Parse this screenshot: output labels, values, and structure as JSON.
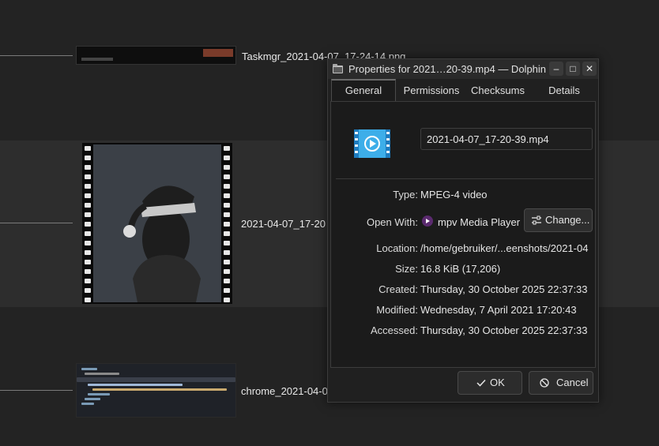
{
  "files": [
    {
      "name": "Taskmgr_2021-04-07_17-24-14.png"
    },
    {
      "name": "2021-04-07_17-20"
    },
    {
      "name": "chrome_2021-04-0"
    }
  ],
  "dialog": {
    "title": "Properties for 2021…20-39.mp4 — Dolphin",
    "window_buttons": {
      "minimize": "–",
      "maximize": "□",
      "close": "✕"
    },
    "tabs": [
      {
        "label": "General",
        "active": true
      },
      {
        "label": "Permissions",
        "active": false
      },
      {
        "label": "Checksums",
        "active": false
      },
      {
        "label": "Details",
        "active": false
      }
    ],
    "filename": "2021-04-07_17-20-39.mp4",
    "fields": {
      "type_label": "Type:",
      "type_value": "MPEG-4 video",
      "open_with_label": "Open With:",
      "open_with_value": "mpv Media Player",
      "change_button": "Change...",
      "location_label": "Location:",
      "location_value": "/home/gebruiker/...eenshots/2021-04",
      "size_label": "Size:",
      "size_value": "16.8 KiB (17,206)",
      "created_label": "Created:",
      "created_value": "Thursday, 30 October 2025 22:37:33",
      "modified_label": "Modified:",
      "modified_value": "Wednesday, 7 April 2021 17:20:43",
      "accessed_label": "Accessed:",
      "accessed_value": "Thursday, 30 October 2025 22:37:33"
    },
    "buttons": {
      "ok": "OK",
      "cancel": "Cancel"
    },
    "icons": {
      "file": "video-file-icon",
      "open_with": "mpv-icon",
      "change": "configure-icon",
      "ok": "check-icon",
      "cancel": "cancel-icon"
    }
  },
  "colors": {
    "accent": "#3daee9",
    "mpv": "#5a2a6e"
  }
}
